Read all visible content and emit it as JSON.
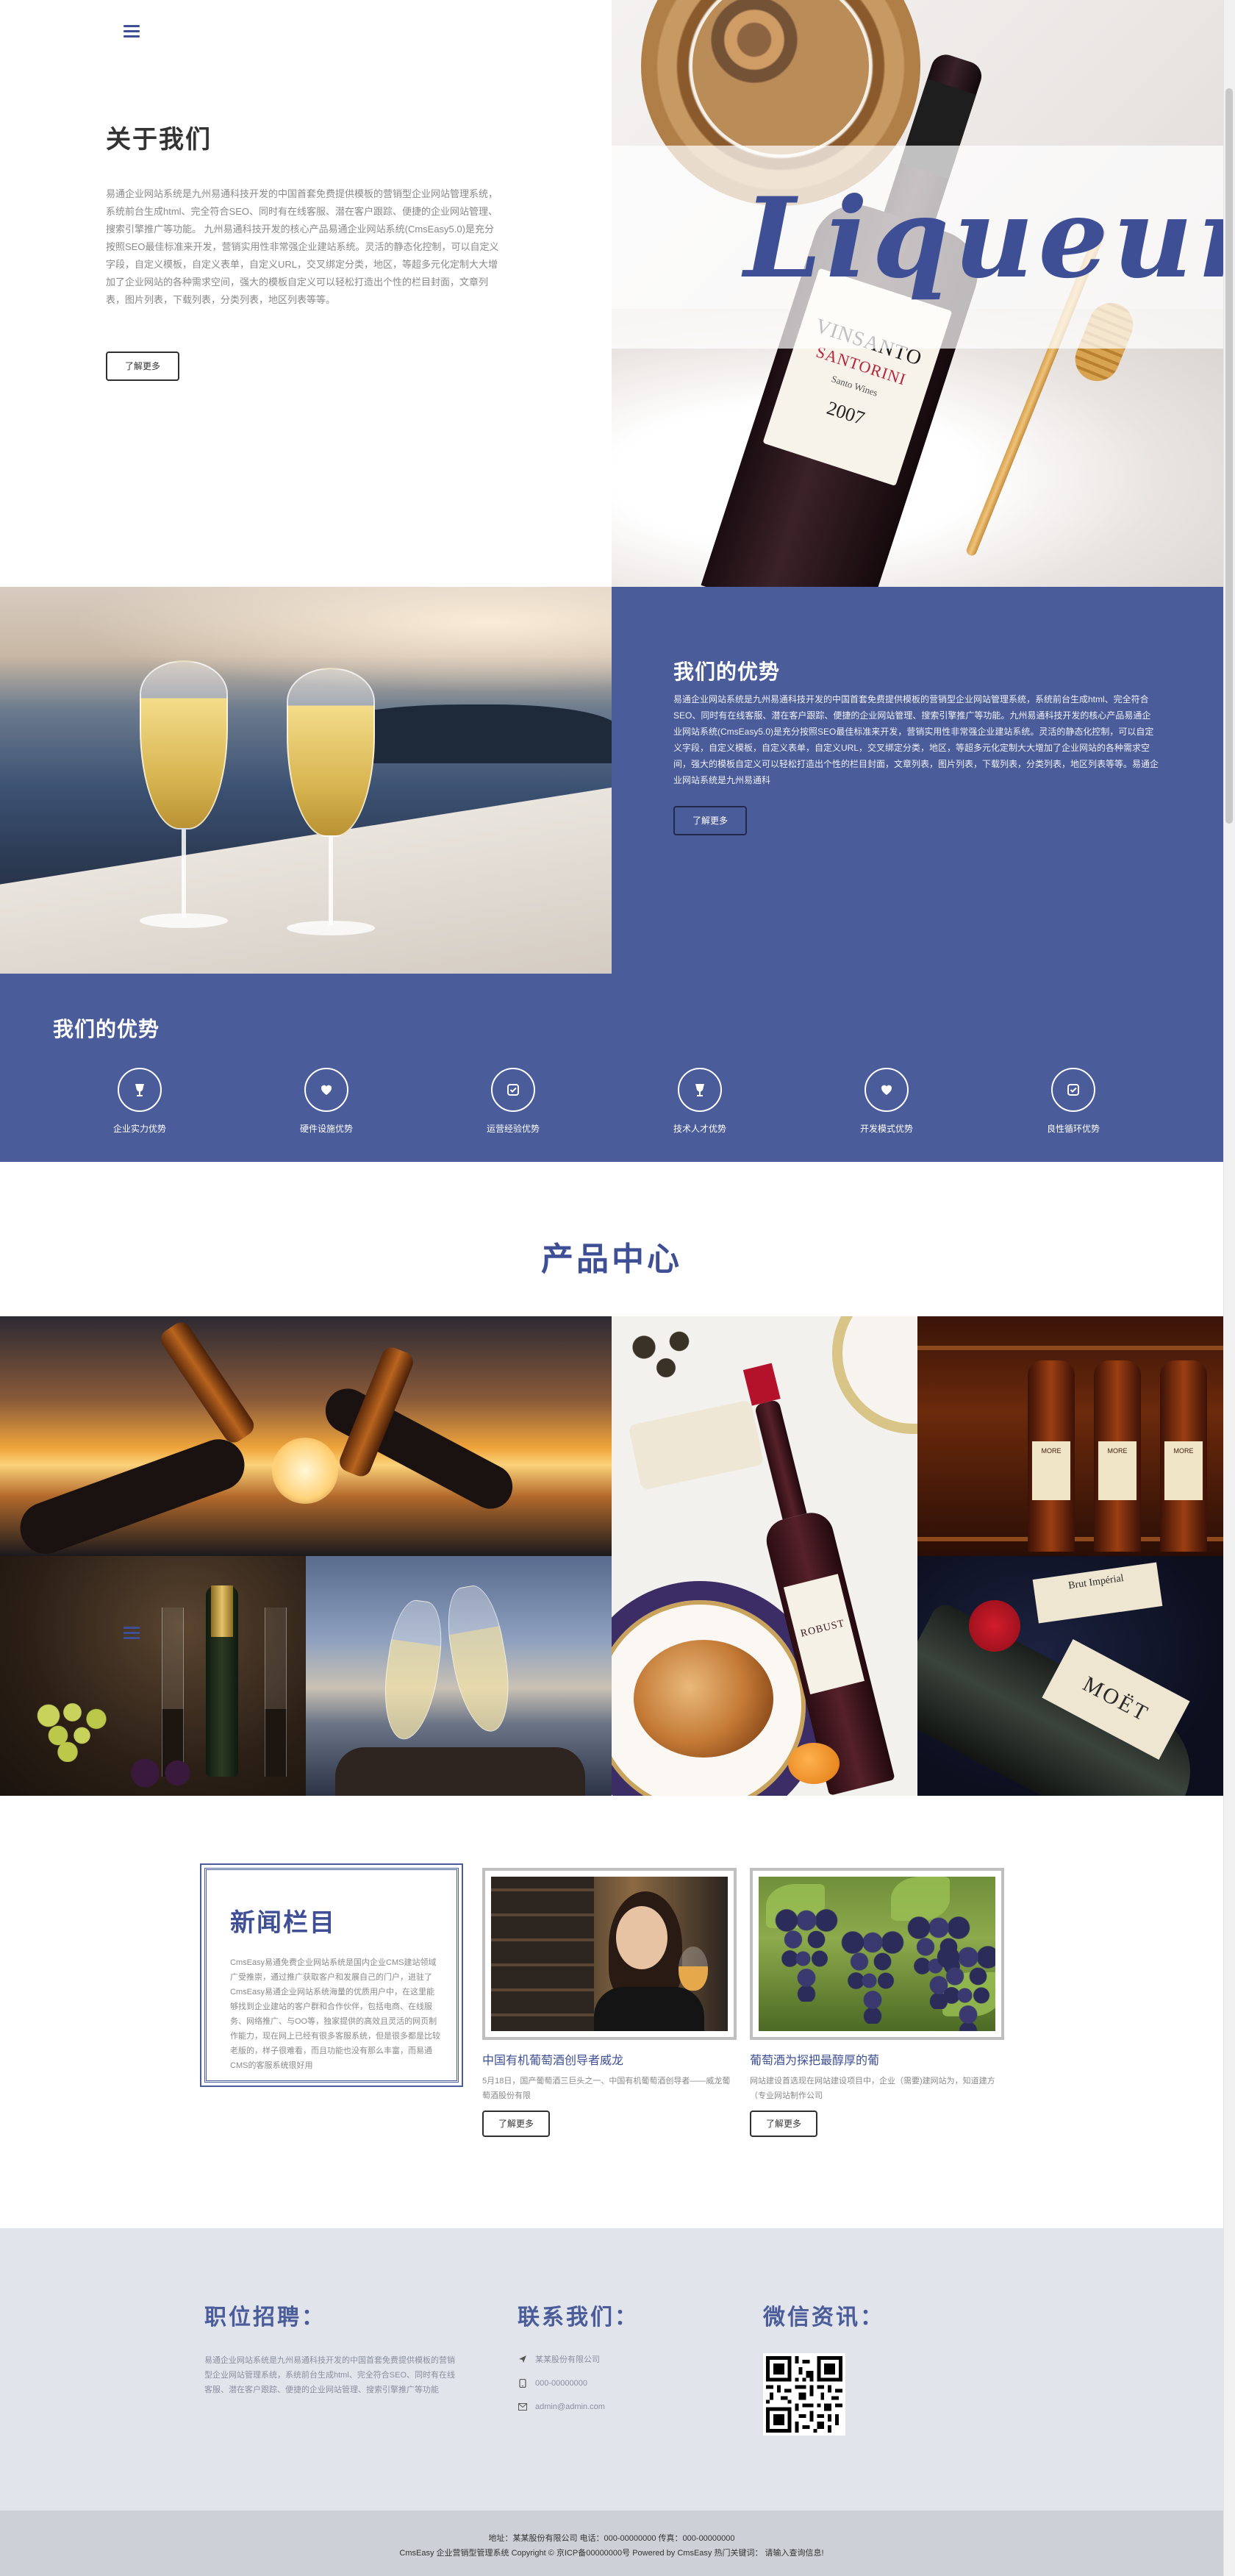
{
  "about": {
    "title": "关于我们",
    "text": "易通企业网站系统是九州易通科技开发的中国首套免费提供模板的营销型企业网站管理系统，系统前台生成html、完全符合SEO、同时有在线客服、潜在客户跟踪、便捷的企业网站管理、搜索引擎推广等功能。 九州易通科技开发的核心产品易通企业网站系统(CmsEasy5.0)是充分按照SEO最佳标准来开发，营销实用性非常强企业建站系统。灵活的静态化控制，可以自定义字段，自定义模板，自定义表单，自定义URL，交叉绑定分类，地区，等超多元化定制大大增加了企业网站的各种需求空间，强大的模板自定义可以轻松打造出个性的栏目封面，文章列表，图片列表，下载列表，分类列表，地区列表等等。",
    "button": "了解更多"
  },
  "hero_image": {
    "overlay_word": "Liqueur",
    "bottle_label_line1": "VINSANTO",
    "bottle_label_line2": "SANTORINI",
    "bottle_label_line3": "Santo Wines",
    "bottle_year": "2007"
  },
  "advantages_block": {
    "title": "我们的优势",
    "text": "易通企业网站系统是九州易通科技开发的中国首套免费提供模板的营销型企业网站管理系统，系统前台生成html、完全符合SEO、同时有在线客服、潜在客户跟踪、便捷的企业网站管理、搜索引擎推广等功能。九州易通科技开发的核心产品易通企业网站系统(CmsEasy5.0)是充分按照SEO最佳标准来开发，营销实用性非常强企业建站系统。灵活的静态化控制，可以自定义字段，自定义模板，自定义表单，自定义URL，交叉绑定分类，地区，等超多元化定制大大增加了企业网站的各种需求空间，强大的模板自定义可以轻松打造出个性的栏目封面，文章列表，图片列表，下载列表，分类列表，地区列表等等。易通企业网站系统是九州易通科",
    "button": "了解更多"
  },
  "advantages_row": {
    "title": "我们的优势",
    "items": [
      {
        "label": "企业实力优势",
        "icon": "goblet-icon"
      },
      {
        "label": "硬件设施优势",
        "icon": "heart-icon"
      },
      {
        "label": "运营经验优势",
        "icon": "check-icon"
      },
      {
        "label": "技术人才优势",
        "icon": "goblet-icon"
      },
      {
        "label": "开发模式优势",
        "icon": "heart-icon"
      },
      {
        "label": "良性循环优势",
        "icon": "check-icon"
      }
    ]
  },
  "products": {
    "title": "产品中心",
    "bottle_label_robust": "ROBUST",
    "bar_labels": [
      "MORE",
      "MORE",
      "MORE"
    ],
    "moet_label": "MOËT",
    "moet_tag": "Brut Impérial"
  },
  "news": {
    "box_title": "新闻栏目",
    "box_text": "CmsEasy易通免费企业网站系统是国内企业CMS建站领域广受推崇，通过推广获取客户和发展自己的门户，进驻了CmsEasy易通企业网站系统海量的优质用户中，在这里能够找到企业建站的客户群和合作伙伴，包括电商、在线服务、网络推广、与OO等，独家提供的高效且灵活的网页制作能力，现在网上已经有很多客服系统，但是很多都是比较老版的，样子很难看，而且功能也没有那么丰富，而易通CMS的客服系统很好用",
    "cards": [
      {
        "title": "中国有机葡萄酒创导者威龙",
        "text": "5月18日，国产葡萄酒三巨头之一、中国有机葡萄酒创导者——威龙葡萄酒股份有限",
        "button": "了解更多"
      },
      {
        "title": "葡萄酒为探把最醇厚的葡",
        "text": "网站建设首选现在网站建设项目中，企业（需要)建网站为，知道建方（专业网站制作公司",
        "button": "了解更多"
      }
    ]
  },
  "footer": {
    "recruit": {
      "title": "职位招聘：",
      "text": "易通企业网站系统是九州易通科技开发的中国首套免费提供模板的营销型企业网站管理系统，系统前台生成html、完全符合SEO、同时有在线客服、潜在客户跟踪、便捷的企业网站管理、搜索引擎推广等功能"
    },
    "contact": {
      "title": "联系我们：",
      "company": "某某股份有限公司",
      "phone": "000-00000000",
      "email": "admin@admin.com"
    },
    "wechat": {
      "title": "微信资讯："
    }
  },
  "copyright": {
    "line1": "地址：某某股份有限公司   电话：000-00000000   传真：000-00000000",
    "line2": "CmsEasy 企业营销型管理系统 Copyright ©   京ICP备00000000号   Powered by CmsEasy     热门关键词：  请输入查询信息!"
  },
  "colors": {
    "brand_blue": "#4a5c9a",
    "title_blue": "#3f4f96",
    "footer_bg": "#e1e4ea"
  }
}
